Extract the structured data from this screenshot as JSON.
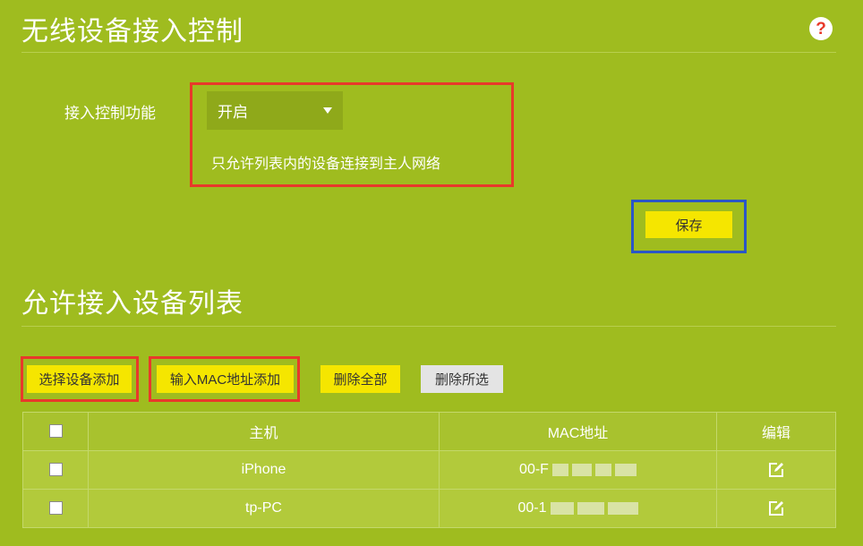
{
  "section1": {
    "title": "无线设备接入控制"
  },
  "help": {
    "glyph": "?"
  },
  "access_control": {
    "label": "接入控制功能",
    "selected": "开启",
    "hint": "只允许列表内的设备连接到主人网络"
  },
  "save_label": "保存",
  "section2": {
    "title": "允许接入设备列表"
  },
  "toolbar": {
    "select_add": "选择设备添加",
    "mac_add": "输入MAC地址添加",
    "delete_all": "删除全部",
    "delete_selected": "删除所选"
  },
  "table": {
    "headers": [
      "主机",
      "MAC地址",
      "编辑"
    ],
    "rows": [
      {
        "host": "iPhone",
        "mac_visible": "00-F"
      },
      {
        "host": "tp-PC",
        "mac_visible": "00-1"
      }
    ]
  },
  "colors": {
    "background": "#9fbc1f",
    "highlight_red": "#e8392a",
    "highlight_blue": "#2b56c6",
    "button_yellow": "#f5e600",
    "button_gray": "#e4e4e4"
  },
  "icons": {
    "help": "help-icon",
    "dropdown": "caret-down-icon",
    "edit": "edit-icon"
  }
}
